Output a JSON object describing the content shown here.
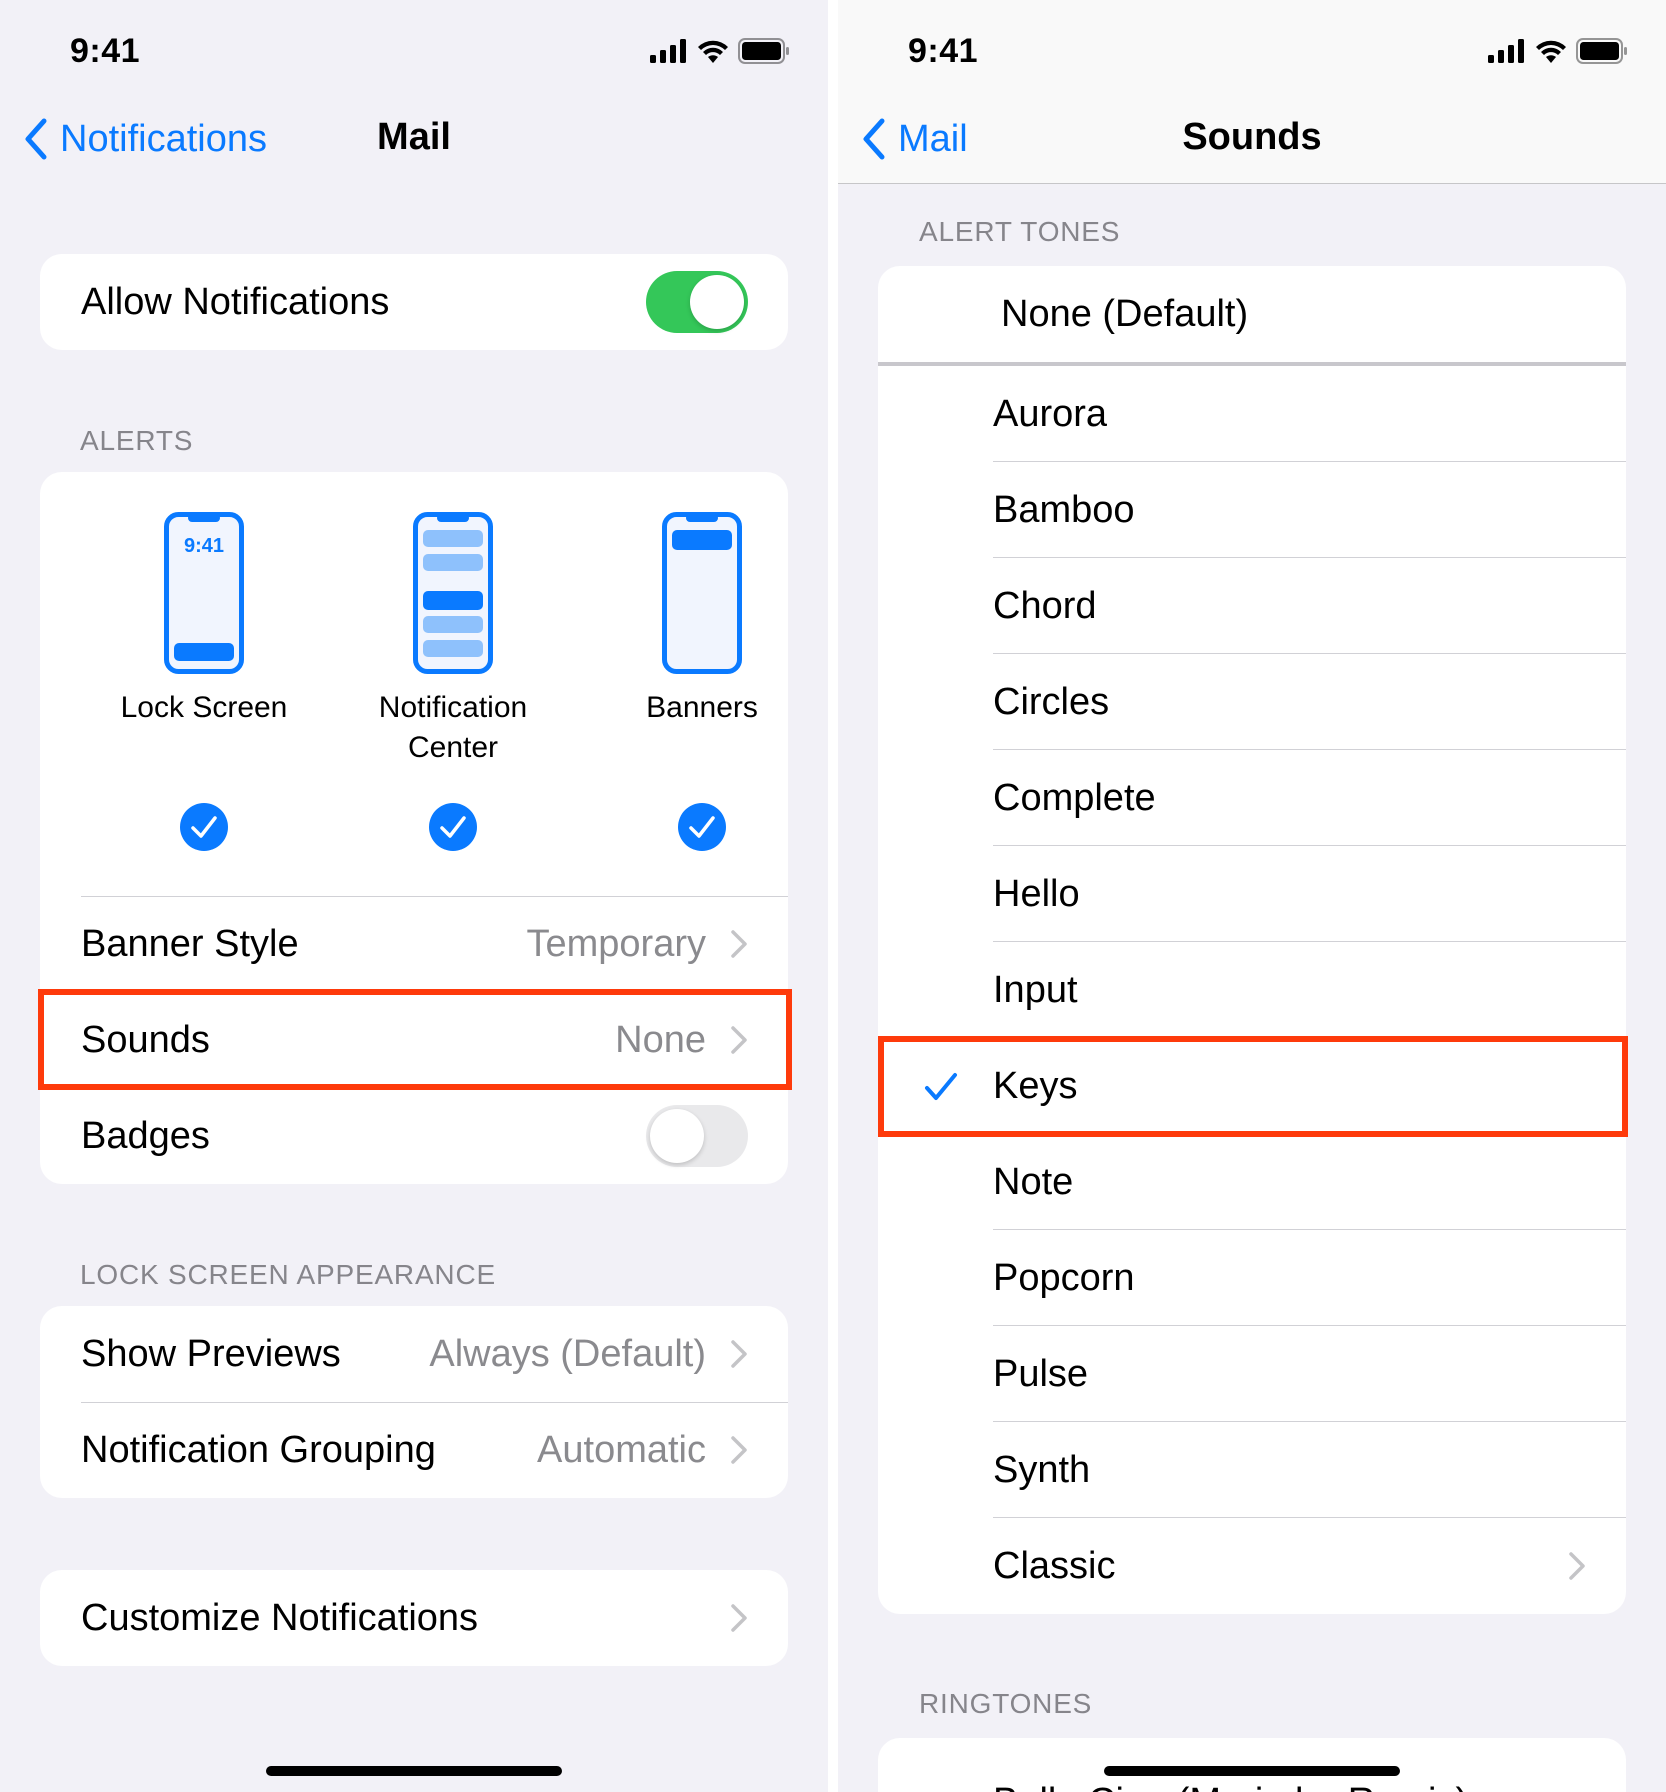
{
  "left": {
    "status_time": "9:41",
    "nav": {
      "back_label": "Notifications",
      "title": "Mail"
    },
    "allow_notifications": {
      "label": "Allow Notifications",
      "enabled": true
    },
    "alerts_header": "ALERTS",
    "alert_styles": [
      {
        "name_line1": "Lock Screen",
        "name_line2": "",
        "phone_time": "9:41",
        "checked": true
      },
      {
        "name_line1": "Notification",
        "name_line2": "Center",
        "checked": true
      },
      {
        "name_line1": "Banners",
        "name_line2": "",
        "checked": true
      }
    ],
    "banner_style": {
      "label": "Banner Style",
      "value": "Temporary"
    },
    "sounds": {
      "label": "Sounds",
      "value": "None"
    },
    "badges": {
      "label": "Badges",
      "enabled": false
    },
    "lock_screen_header": "LOCK SCREEN APPEARANCE",
    "show_previews": {
      "label": "Show Previews",
      "value": "Always (Default)"
    },
    "notification_grouping": {
      "label": "Notification Grouping",
      "value": "Automatic"
    },
    "customize": {
      "label": "Customize Notifications"
    }
  },
  "right": {
    "status_time": "9:41",
    "nav": {
      "back_label": "Mail",
      "title": "Sounds"
    },
    "alert_tones_header": "ALERT TONES",
    "default_tone": "None (Default)",
    "tones": [
      "Aurora",
      "Bamboo",
      "Chord",
      "Circles",
      "Complete",
      "Hello",
      "Input",
      "Keys",
      "Note",
      "Popcorn",
      "Pulse",
      "Synth",
      "Classic"
    ],
    "selected_tone": "Keys",
    "ringtones_header": "RINGTONES",
    "first_ringtone": "Bella Ciao (Marimba Remix)"
  },
  "colors": {
    "accent": "#0a7aff",
    "toggle_on": "#34c759",
    "highlight": "#fe3a0b",
    "background": "#f2f1f7"
  }
}
